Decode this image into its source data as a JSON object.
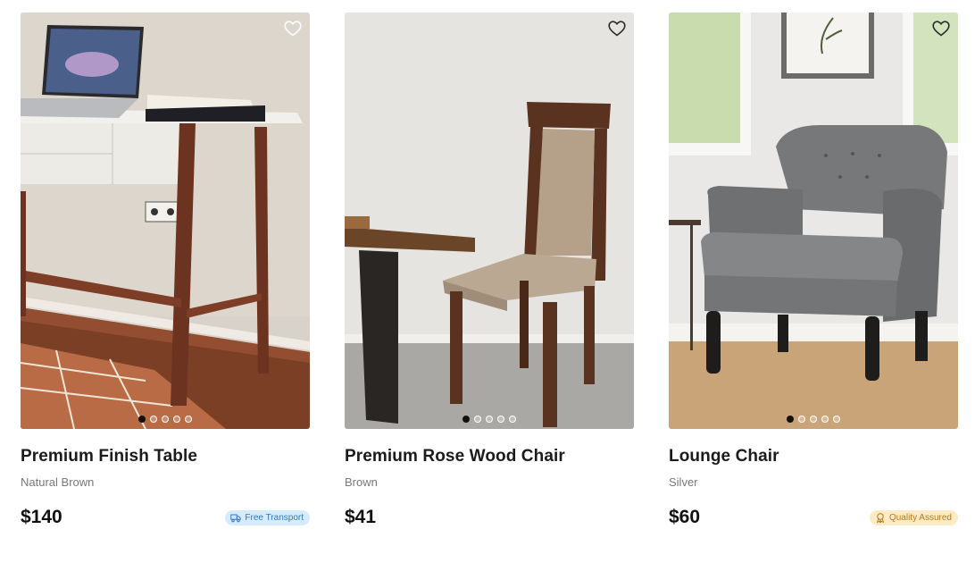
{
  "products": [
    {
      "name": "Premium Finish Table",
      "variant": "Natural Brown",
      "price": "$140",
      "badge": {
        "label": "Free Transport",
        "icon": "truck-icon",
        "color": "#2f79c6",
        "background": "#d6ebff"
      },
      "image_dots": {
        "count": 5,
        "active_index": 0
      }
    },
    {
      "name": "Premium Rose Wood Chair",
      "variant": "Brown",
      "price": "$41",
      "badge": null,
      "image_dots": {
        "count": 5,
        "active_index": 0
      }
    },
    {
      "name": "Lounge Chair",
      "variant": "Silver",
      "price": "$60",
      "badge": {
        "label": "Quality Assured",
        "icon": "award-ribbon-icon",
        "color": "#b7781d",
        "background": "#fdebc6"
      },
      "image_dots": {
        "count": 5,
        "active_index": 0
      }
    }
  ],
  "icons": {
    "favorite": "heart-outline-icon"
  }
}
